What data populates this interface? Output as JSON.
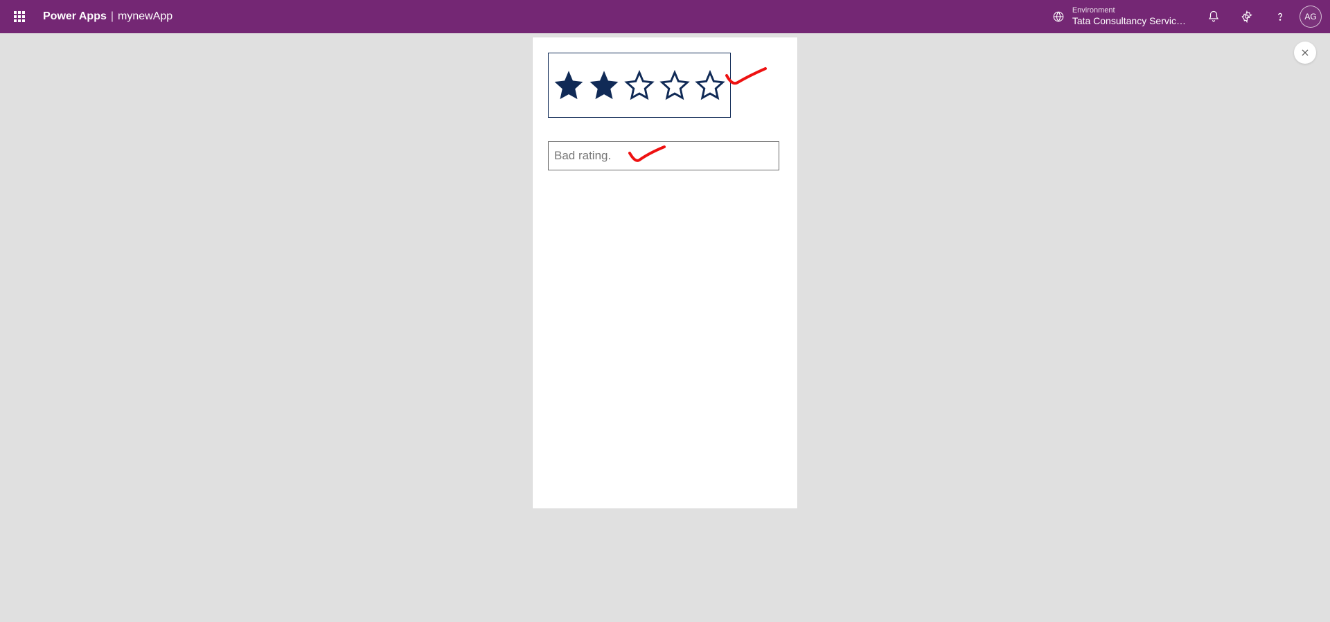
{
  "header": {
    "product": "Power Apps",
    "separator": "|",
    "appName": "mynewApp",
    "environmentLabel": "Environment",
    "environmentName": "Tata Consultancy Servic…",
    "avatarInitials": "AG"
  },
  "canvas": {
    "rating": {
      "value": 2,
      "max": 5
    },
    "textField": {
      "value": "Bad rating."
    }
  },
  "annotations": {
    "starCheck": true,
    "textCheck": true
  },
  "colors": {
    "brand": "#742774",
    "starFill": "#102a56",
    "annotationRed": "#e11"
  }
}
